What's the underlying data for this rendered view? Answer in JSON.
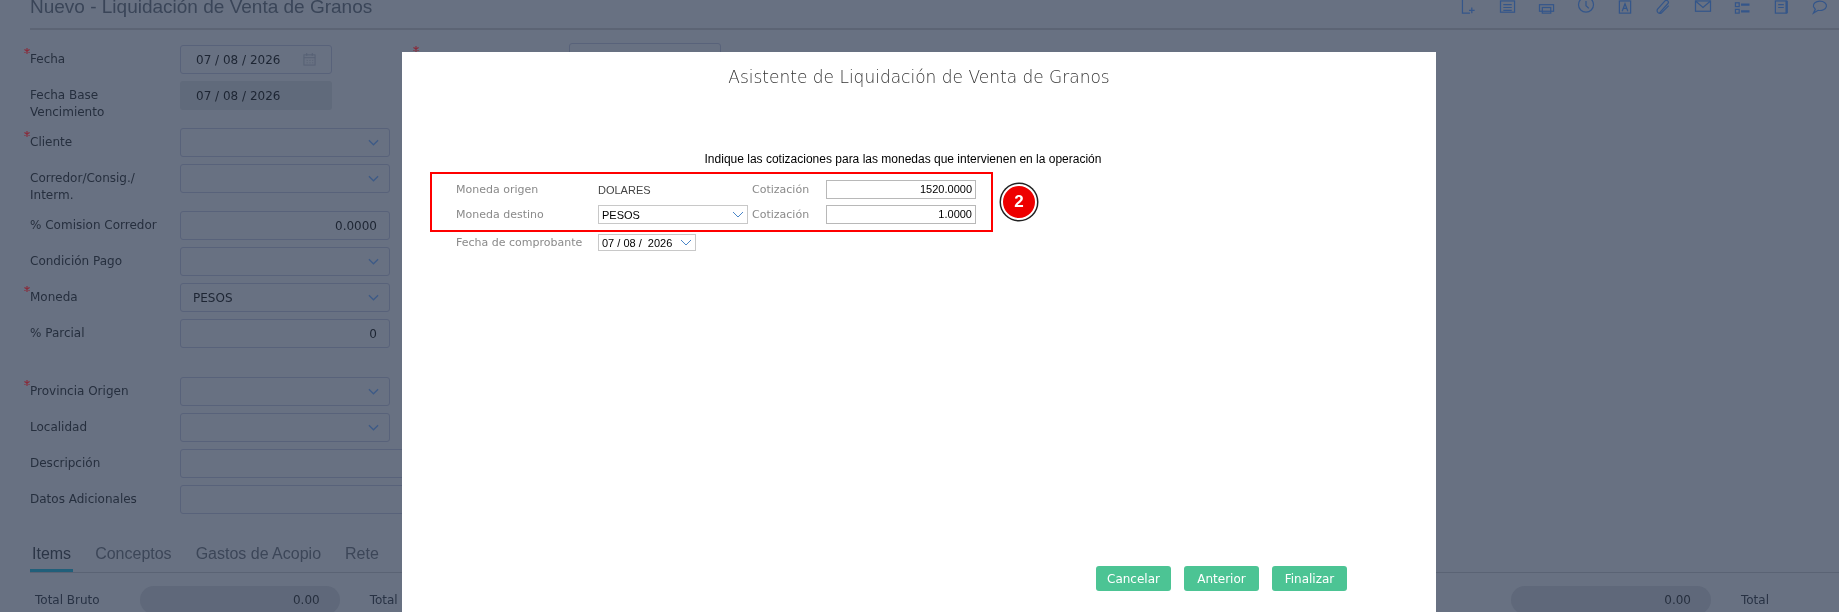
{
  "page": {
    "title": "Nuevo - Liquidación de Venta de Granos"
  },
  "form": {
    "sections": [
      [
        {
          "label": "Fecha",
          "required": true,
          "kind": "date",
          "value": "07 / 08 / 2026"
        },
        {
          "label": "Fecha Base Vencimiento",
          "required": false,
          "kind": "plain",
          "value": "07 / 08 / 2026"
        },
        {
          "label": "Cliente",
          "required": true,
          "kind": "select"
        },
        {
          "label": "Corredor/Consig./ Interm.",
          "required": false,
          "kind": "select"
        },
        {
          "label": "% Comision Corredor",
          "required": false,
          "kind": "number",
          "value": "0.0000"
        },
        {
          "label": "Condición Pago",
          "required": false,
          "kind": "select"
        },
        {
          "label": "Moneda",
          "required": true,
          "kind": "select",
          "value": "PESOS"
        },
        {
          "label": "% Parcial",
          "required": false,
          "kind": "number",
          "value": "0"
        }
      ],
      [
        {
          "label": "Provincia Origen",
          "required": true,
          "kind": "select"
        },
        {
          "label": "Localidad",
          "required": false,
          "kind": "select"
        },
        {
          "label": "Descripción",
          "required": false,
          "kind": "text"
        },
        {
          "label": "Datos Adicionales",
          "required": false,
          "kind": "text"
        }
      ]
    ],
    "side_field": {
      "required": true
    }
  },
  "tabs": [
    {
      "label": "Items",
      "selected": true
    },
    {
      "label": "Conceptos",
      "selected": false
    },
    {
      "label": "Gastos de Acopio",
      "selected": false
    },
    {
      "label": "Rete",
      "selected": false
    }
  ],
  "totals": [
    {
      "kind": "label",
      "text": "Total Bruto"
    },
    {
      "kind": "value",
      "text": "0.00"
    },
    {
      "kind": "label",
      "text": "Total"
    },
    {
      "kind": "value",
      "text": "0.00"
    },
    {
      "kind": "label",
      "text": "Total"
    }
  ],
  "dialog": {
    "title": "Asistente de Liquidación de Venta de Granos",
    "instruction": "Indique las cotizaciones para las monedas que intervienen en la operación",
    "currency_rows": [
      {
        "label": "Moneda origen",
        "kind": "text",
        "value": "DOLARES",
        "rate_label": "Cotización",
        "rate": "1520.0000"
      },
      {
        "label": "Moneda destino",
        "kind": "select",
        "value": "PESOS",
        "rate_label": "Cotización",
        "rate": "1.0000"
      }
    ],
    "date_row": {
      "label": "Fecha de comprobante",
      "value": "07 / 08 /  2026"
    },
    "callout": "2",
    "buttons": [
      "Cancelar",
      "Anterior",
      "Finalizar"
    ]
  }
}
